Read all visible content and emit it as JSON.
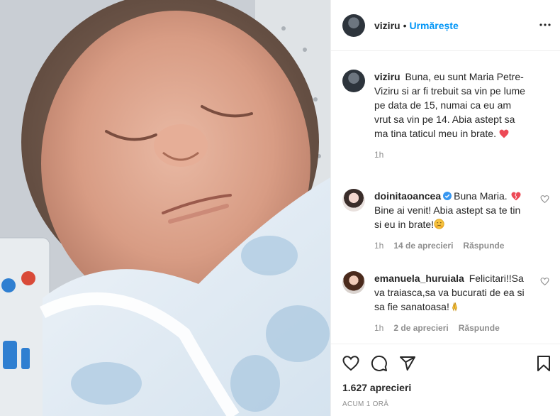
{
  "post": {
    "author": "viziru",
    "follow_label": "Urmărește",
    "dot": "•",
    "caption_text": "Buna, eu sunt Maria Petre-Viziru si ar fi trebuit sa vin pe lume pe data de 15, numai ca eu am vrut sa vin pe 14. Abia astept sa ma tina taticul meu in brate.",
    "caption_time": "1h",
    "likes_count_label": "1.627 aprecieri",
    "timestamp_label": "ACUM 1 ORĂ"
  },
  "comments": [
    {
      "user": "doinitaoancea",
      "verified": true,
      "text": "Buna Maria. ",
      "text2": "Bine ai venit! Abia astept sa te tin si eu in brate!",
      "time": "1h",
      "likes": "14 de aprecieri",
      "reply": "Răspunde"
    },
    {
      "user": "emanuela_huruiala",
      "verified": false,
      "text": "Felicitari!!Sa va traiasca,sa va bucurati de ea si sa fie sanatoasa!",
      "time": "1h",
      "likes": "2 de aprecieri",
      "reply": "Răspunde"
    }
  ],
  "icons": {
    "more": "more-options-icon",
    "like": "heart-icon",
    "comment": "comment-icon",
    "share": "share-icon",
    "save": "bookmark-icon"
  },
  "colors": {
    "accent": "#0095f6",
    "verified": "#3897f0",
    "red_heart": "#ed4956",
    "text": "#262626",
    "muted": "#8e8e8e"
  }
}
